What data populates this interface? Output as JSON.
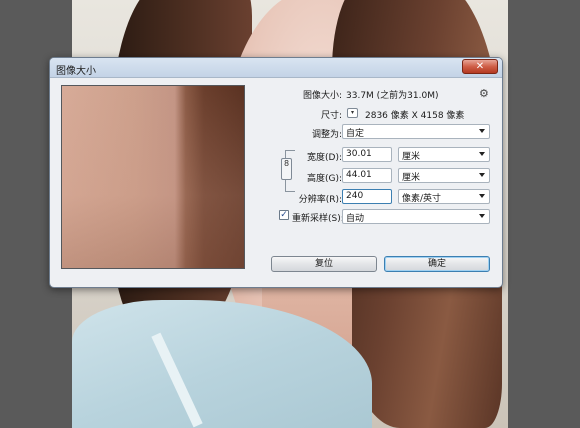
{
  "dialog": {
    "title": "图像大小",
    "close_label": "✕"
  },
  "info": {
    "image_size_label": "图像大小:",
    "image_size_value": "33.7M (之前为31.0M)",
    "dimensions_label": "尺寸:",
    "dimensions_value": "2836 像素  X  4158 像素"
  },
  "fields": {
    "fit_to_label": "调整为:",
    "fit_to_value": "自定",
    "width_label": "宽度(D):",
    "width_value": "30.01",
    "width_unit": "厘米",
    "height_label": "高度(G):",
    "height_value": "44.01",
    "height_unit": "厘米",
    "resolution_label": "分辨率(R):",
    "resolution_value": "240",
    "resolution_unit": "像素/英寸",
    "resample_label": "重新采样(S):",
    "resample_value": "自动",
    "resample_checked": "✓"
  },
  "buttons": {
    "reset_label": "复位",
    "ok_label": "确定"
  },
  "icons": {
    "gear": "⚙",
    "chain": "8",
    "dropdown": "▾"
  }
}
